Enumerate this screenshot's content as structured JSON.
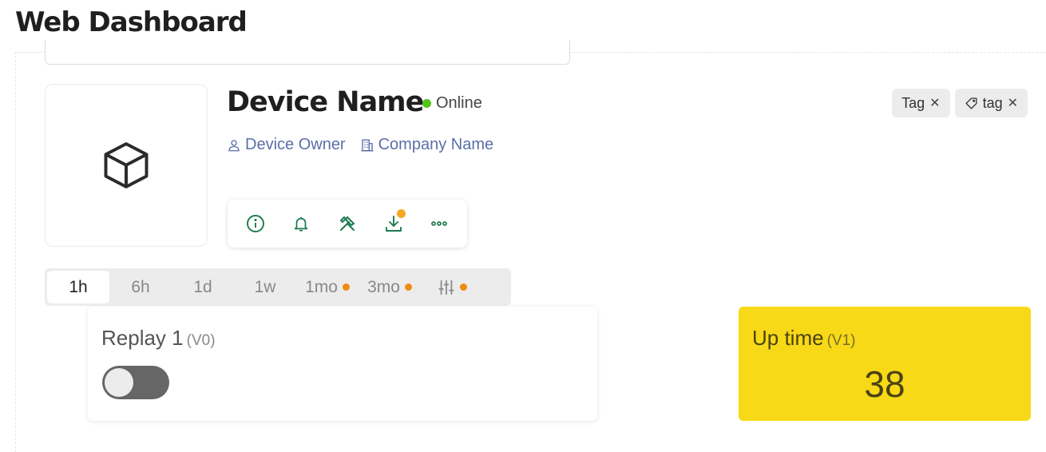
{
  "page": {
    "title": "Web Dashboard"
  },
  "device": {
    "name": "Device Name",
    "status": "Online",
    "status_color": "#52c41a",
    "owner": "Device Owner",
    "company": "Company Name",
    "image_icon": "cube-icon"
  },
  "tags": [
    {
      "label": "Tag",
      "icon": null
    },
    {
      "label": "tag",
      "icon": "tag-icon"
    }
  ],
  "actions": [
    {
      "icon": "info-icon"
    },
    {
      "icon": "bell-icon"
    },
    {
      "icon": "tools-icon"
    },
    {
      "icon": "download-icon",
      "has_notification": true
    },
    {
      "icon": "more-icon"
    }
  ],
  "time_ranges": [
    {
      "label": "1h",
      "active": true
    },
    {
      "label": "6h"
    },
    {
      "label": "1d"
    },
    {
      "label": "1w"
    },
    {
      "label": "1mo",
      "dot": true
    },
    {
      "label": "3mo",
      "dot": true
    },
    {
      "icon": "sliders-icon",
      "dot": true
    }
  ],
  "widgets": {
    "replay": {
      "label": "Replay 1",
      "pin": "(V0)",
      "toggle_on": false
    },
    "uptime": {
      "label": "Up time",
      "pin": "(V1)",
      "value": "38",
      "bg_color": "#f8d917"
    }
  },
  "colors": {
    "accent": "#1e7a50",
    "link": "#5b6fa8",
    "warning_dot": "#ef8a13"
  }
}
